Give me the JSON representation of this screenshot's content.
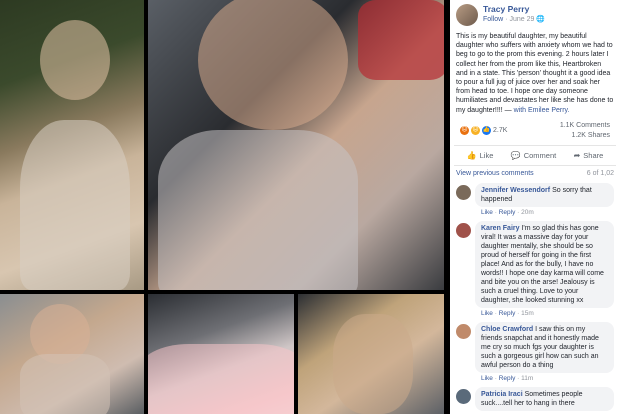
{
  "post": {
    "author": "Tracy Perry",
    "follow_label": "Follow",
    "separator": "·",
    "date": "June 29",
    "privacy_icon": "globe-icon",
    "text": "This is my beautiful daughter, my beautiful daughter who suffers with anxiety whom we had to beg to go to the prom this evening. 2 hours later I collect her from the prom like this, Heartbroken and in a state. This 'person' thought it a good idea to pour a full jug of juice over her and soak her from head to toe. I hope one day someone humiliates and devastates her like she has done to my daughter!!!! —",
    "with_text": "with Emilee Perry."
  },
  "reactions": {
    "count": "2.7K",
    "comments": "1.1K Comments",
    "shares": "1.2K Shares",
    "icons": [
      "angry-icon",
      "sad-icon",
      "like-icon"
    ]
  },
  "actions": {
    "like": "Like",
    "comment": "Comment",
    "share": "Share"
  },
  "comments_header": {
    "view_previous": "View previous comments",
    "count": "6 of 1,02"
  },
  "comment_footer": {
    "like": "Like",
    "reply": "Reply",
    "dot": "·"
  },
  "comments": [
    {
      "name": "Jennifer Wessendorf",
      "text": "So sorry that happened",
      "time": "20m"
    },
    {
      "name": "Karen Fairy",
      "text": "I'm so glad this has gone viral! It was a massive day for your daughter mentally, she should be so proud of herself for going in the first place! And as for the bully, I have no words!! I hope one day karma will come and bite you on the arse! Jealousy is such a cruel thing. Love to your daughter, she looked stunning xx",
      "time": "15m"
    },
    {
      "name": "Chloe Crawford",
      "text": "I saw this on my friends snapchat and it honestly made me cry so much fgs your daughter is such a gorgeous girl how can such an awful person do a thing",
      "time": "11m"
    },
    {
      "name": "Patricia Iraci",
      "text": "Sometimes people suck....tell her to hang in there",
      "time": ""
    }
  ],
  "colors": {
    "link_blue": "#385898",
    "angry": "#e9710f",
    "sad": "#f7b125",
    "like": "#1877f2"
  }
}
